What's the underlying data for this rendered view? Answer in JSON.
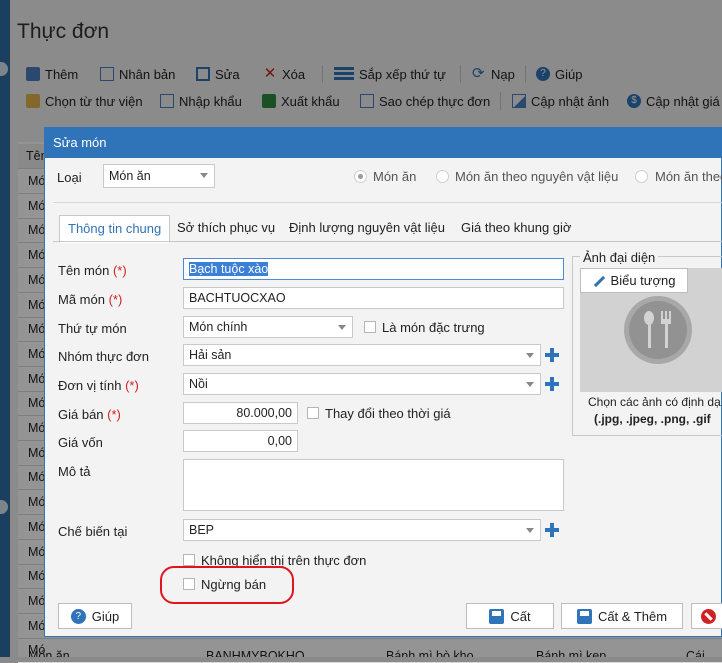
{
  "app": {
    "title": "Thực đơn",
    "toolbar1": [
      "Thêm",
      "Nhân bản",
      "Sửa",
      "Xóa",
      "Sắp xếp thứ tự",
      "Nạp",
      "Giúp"
    ],
    "toolbar2": [
      "Chọn từ thư viện",
      "Nhập khẩu",
      "Xuất khẩu",
      "Sao chép thực đơn",
      "Cập nhật ảnh",
      "Cập nhật giá"
    ],
    "grid": {
      "header_first": "Tên",
      "left_cells": [
        "Mó",
        "Mó",
        "Mó",
        "Mó",
        "Mó",
        "Mó",
        "Mó",
        "Mó",
        "Mó",
        "Mó",
        "Mó",
        "Mó",
        "Mó",
        "Mó",
        "Mó",
        "Mó",
        "Mó",
        "Mó",
        "Mó",
        "Mó"
      ],
      "bottom_row": [
        "Món ăn",
        "BANHMYBOKHO",
        "Bánh mì bò kho",
        "Bánh mì kẹp",
        "Cái"
      ]
    }
  },
  "dialog": {
    "title": "Sửa món",
    "type_label": "Loại",
    "type_value": "Món ăn",
    "radios": [
      "Món ăn",
      "Món ăn theo nguyên vật liệu",
      "Món ăn theo"
    ],
    "tabs": [
      "Thông tin chung",
      "Sở thích phục vụ",
      "Định lượng nguyên vật liệu",
      "Giá theo khung giờ"
    ],
    "fields": {
      "ten_mon": {
        "label": "Tên món",
        "req": "(*)",
        "value": "Bạch tuộc xào"
      },
      "ma_mon": {
        "label": "Mã món",
        "req": "(*)",
        "value": "BACHTUOCXAO"
      },
      "thu_tu": {
        "label": "Thứ tự món",
        "value": "Món chính"
      },
      "dac_trung": "Là món đặc trưng",
      "nhom": {
        "label": "Nhóm thực đơn",
        "value": "Hải sản"
      },
      "don_vi": {
        "label": "Đơn vị tính",
        "req": "(*)",
        "value": "Nồi"
      },
      "gia_ban": {
        "label": "Giá bán",
        "req": "(*)",
        "value": "80.000,00"
      },
      "thay_doi": "Thay đổi theo thời giá",
      "gia_von": {
        "label": "Giá vốn",
        "value": "0,00"
      },
      "mo_ta": {
        "label": "Mô tả",
        "value": ""
      },
      "che_bien": {
        "label": "Chế biến tại",
        "value": "BEP"
      },
      "khong_hien_thi": "Không hiển thị trên thực đơn",
      "ngung_ban": "Ngừng bán"
    },
    "avatar": {
      "label": "Ảnh đại diện",
      "button": "Biểu tượng",
      "hint1": "Chọn các ảnh có định dạ",
      "hint2": "(.jpg, .jpeg, .png, .gif"
    },
    "buttons": {
      "help": "Giúp",
      "save": "Cất",
      "save_add": "Cất & Thêm"
    },
    "colors": {
      "accent": "#2f73b8",
      "highlight_circle": "#e0141e"
    }
  }
}
